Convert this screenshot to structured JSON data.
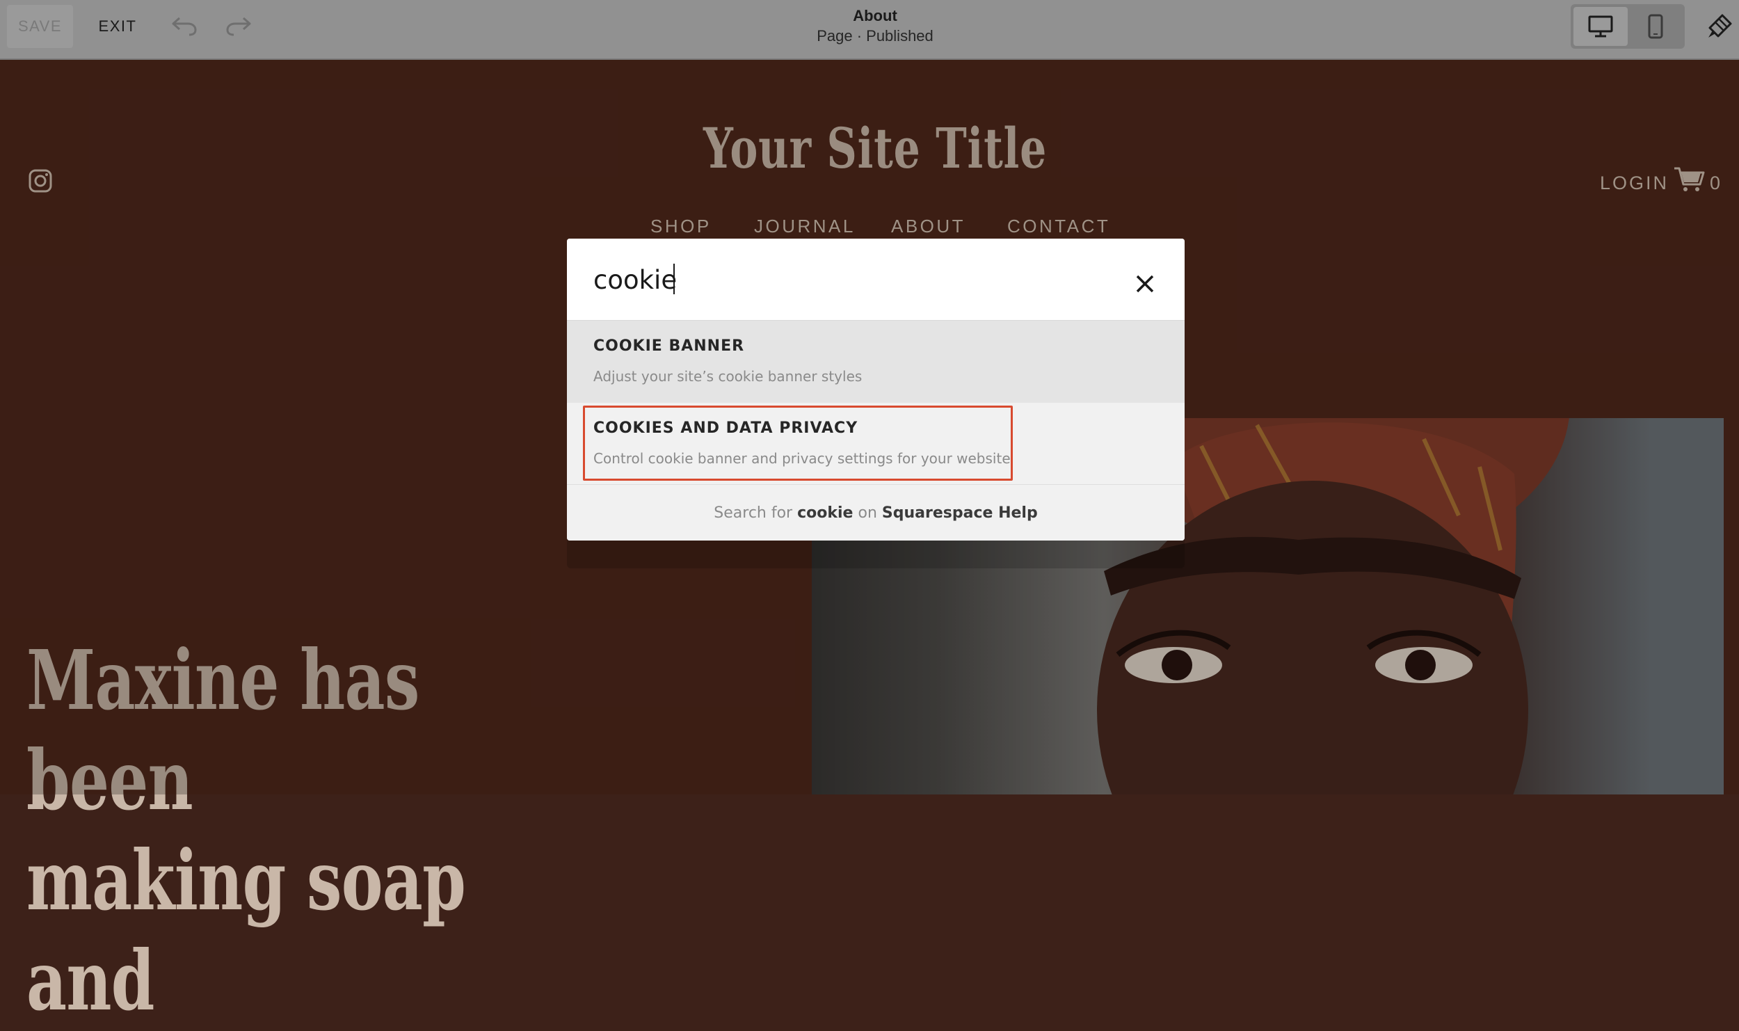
{
  "editor": {
    "save_label": "SAVE",
    "exit_label": "EXIT",
    "page_title": "About",
    "page_status": "Page · Published"
  },
  "site": {
    "title": "Your Site Title",
    "login_label": "LOGIN",
    "cart_count": "0",
    "nav": [
      "SHOP",
      "JOURNAL",
      "ABOUT",
      "CONTACT"
    ],
    "hero_line_1": "Maxine has been",
    "hero_line_2": "making soap and"
  },
  "search": {
    "query": "cookie",
    "results": [
      {
        "title": "COOKIE BANNER",
        "description": "Adjust your site’s cookie banner styles"
      },
      {
        "title": "COOKIES AND DATA PRIVACY",
        "description": "Control cookie banner and privacy settings for your website"
      }
    ],
    "help_prefix": "Search for",
    "help_query": "cookie",
    "help_middle": "on",
    "help_target": "Squarespace Help"
  },
  "colors": {
    "site_background": "#4f281b",
    "highlight_border": "#d84a2f"
  }
}
